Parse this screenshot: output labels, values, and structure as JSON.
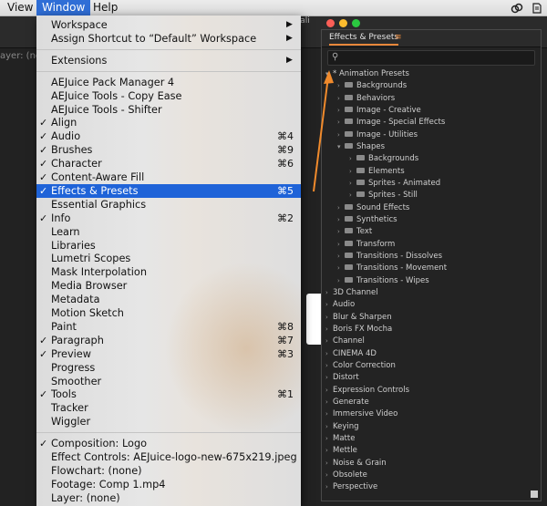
{
  "menubar": {
    "items": [
      "View",
      "Window",
      "Help"
    ],
    "active_index": 1
  },
  "window_menu": {
    "groups": [
      [
        {
          "label": "Workspace",
          "submenu": true
        },
        {
          "label": "Assign Shortcut to “Default” Workspace",
          "submenu": true
        }
      ],
      [
        {
          "label": "Extensions",
          "submenu": true
        }
      ],
      [
        {
          "label": "AEJuice Pack Manager 4"
        },
        {
          "label": "AEJuice Tools - Copy Ease"
        },
        {
          "label": "AEJuice Tools - Shifter"
        },
        {
          "label": "Align",
          "checked": true
        },
        {
          "label": "Audio",
          "checked": true,
          "shortcut": "⌘4"
        },
        {
          "label": "Brushes",
          "checked": true,
          "shortcut": "⌘9"
        },
        {
          "label": "Character",
          "checked": true,
          "shortcut": "⌘6"
        },
        {
          "label": "Content-Aware Fill",
          "checked": true
        },
        {
          "label": "Effects & Presets",
          "checked": true,
          "shortcut": "⌘5",
          "selected": true
        },
        {
          "label": "Essential Graphics"
        },
        {
          "label": "Info",
          "checked": true,
          "shortcut": "⌘2"
        },
        {
          "label": "Learn"
        },
        {
          "label": "Libraries"
        },
        {
          "label": "Lumetri Scopes"
        },
        {
          "label": "Mask Interpolation"
        },
        {
          "label": "Media Browser"
        },
        {
          "label": "Metadata"
        },
        {
          "label": "Motion Sketch"
        },
        {
          "label": "Paint",
          "shortcut": "⌘8"
        },
        {
          "label": "Paragraph",
          "checked": true,
          "shortcut": "⌘7"
        },
        {
          "label": "Preview",
          "checked": true,
          "shortcut": "⌘3"
        },
        {
          "label": "Progress"
        },
        {
          "label": "Smoother"
        },
        {
          "label": "Tools",
          "checked": true,
          "shortcut": "⌘1"
        },
        {
          "label": "Tracker"
        },
        {
          "label": "Wiggler"
        }
      ],
      [
        {
          "label": "Composition: Logo",
          "checked": true
        },
        {
          "label": "Effect Controls: AEJuice-logo-new-675x219.jpeg"
        },
        {
          "label": "Flowchart: (none)"
        },
        {
          "label": "Footage: Comp 1.mp4"
        },
        {
          "label": "Layer: (none)"
        }
      ]
    ]
  },
  "panel": {
    "title": "Effects & Presets",
    "search_value": "",
    "tree": [
      {
        "label": "* Animation Presets",
        "depth": 0,
        "expanded": true,
        "folder": false
      },
      {
        "label": "Backgrounds",
        "depth": 1,
        "folder": true
      },
      {
        "label": "Behaviors",
        "depth": 1,
        "folder": true
      },
      {
        "label": "Image - Creative",
        "depth": 1,
        "folder": true
      },
      {
        "label": "Image - Special Effects",
        "depth": 1,
        "folder": true
      },
      {
        "label": "Image - Utilities",
        "depth": 1,
        "folder": true
      },
      {
        "label": "Shapes",
        "depth": 1,
        "folder": true,
        "expanded": true
      },
      {
        "label": "Backgrounds",
        "depth": 2,
        "folder": true
      },
      {
        "label": "Elements",
        "depth": 2,
        "folder": true
      },
      {
        "label": "Sprites - Animated",
        "depth": 2,
        "folder": true
      },
      {
        "label": "Sprites - Still",
        "depth": 2,
        "folder": true
      },
      {
        "label": "Sound Effects",
        "depth": 1,
        "folder": true
      },
      {
        "label": "Synthetics",
        "depth": 1,
        "folder": true
      },
      {
        "label": "Text",
        "depth": 1,
        "folder": true
      },
      {
        "label": "Transform",
        "depth": 1,
        "folder": true
      },
      {
        "label": "Transitions - Dissolves",
        "depth": 1,
        "folder": true
      },
      {
        "label": "Transitions - Movement",
        "depth": 1,
        "folder": true
      },
      {
        "label": "Transitions - Wipes",
        "depth": 1,
        "folder": true
      },
      {
        "label": "3D Channel",
        "depth": 0,
        "folder": false
      },
      {
        "label": "Audio",
        "depth": 0,
        "folder": false
      },
      {
        "label": "Blur & Sharpen",
        "depth": 0,
        "folder": false
      },
      {
        "label": "Boris FX Mocha",
        "depth": 0,
        "folder": false
      },
      {
        "label": "Channel",
        "depth": 0,
        "folder": false
      },
      {
        "label": "CINEMA 4D",
        "depth": 0,
        "folder": false
      },
      {
        "label": "Color Correction",
        "depth": 0,
        "folder": false
      },
      {
        "label": "Distort",
        "depth": 0,
        "folder": false
      },
      {
        "label": "Expression Controls",
        "depth": 0,
        "folder": false
      },
      {
        "label": "Generate",
        "depth": 0,
        "folder": false
      },
      {
        "label": "Immersive Video",
        "depth": 0,
        "folder": false
      },
      {
        "label": "Keying",
        "depth": 0,
        "folder": false
      },
      {
        "label": "Matte",
        "depth": 0,
        "folder": false
      },
      {
        "label": "Mettle",
        "depth": 0,
        "folder": false
      },
      {
        "label": "Noise & Grain",
        "depth": 0,
        "folder": false
      },
      {
        "label": "Obsolete",
        "depth": 0,
        "folder": false
      },
      {
        "label": "Perspective",
        "depth": 0,
        "folder": false
      }
    ]
  },
  "background": {
    "layer_label": "ayer: (none",
    "tab_fragment": "ts/ali"
  },
  "colors": {
    "menu_selection": "#1f63d8",
    "accent_orange": "#e8873a",
    "panel_bg": "#232323"
  }
}
